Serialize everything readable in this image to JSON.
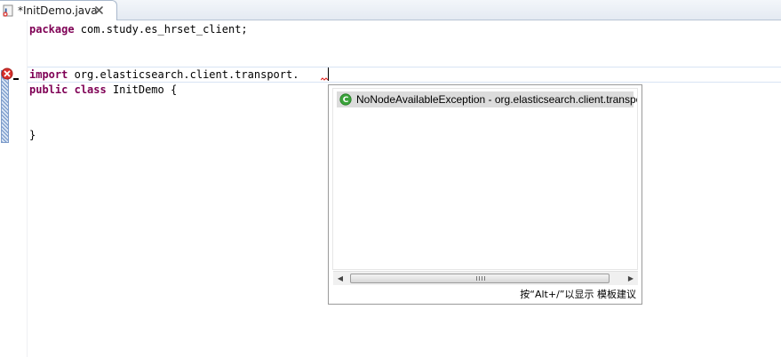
{
  "tab": {
    "label": "*InitDemo.java",
    "file_icon": "java-file-icon",
    "close_icon": "close-icon"
  },
  "code": {
    "line1": {
      "keyword": "package",
      "rest": " com.study.es_hrset_client;"
    },
    "line2": {
      "keyword": "import",
      "rest": " org.elasticsearch.client.transport."
    },
    "line3": {
      "keyword1": "public",
      "keyword2": "class",
      "rest": " InitDemo {"
    },
    "line4": {
      "text": "}"
    }
  },
  "annotations": {
    "error_icon": "error-icon"
  },
  "completion": {
    "items": [
      {
        "label": "NoNodeAvailableException - org.elasticsearch.client.transpo",
        "icon": "class-icon"
      }
    ],
    "status_text": "按“Alt+/”以显示 模板建议"
  },
  "colors": {
    "keyword": "#7f0055",
    "selection": "#dcdcdc",
    "class_icon": "#3aa33a",
    "error": "#d9302c"
  }
}
